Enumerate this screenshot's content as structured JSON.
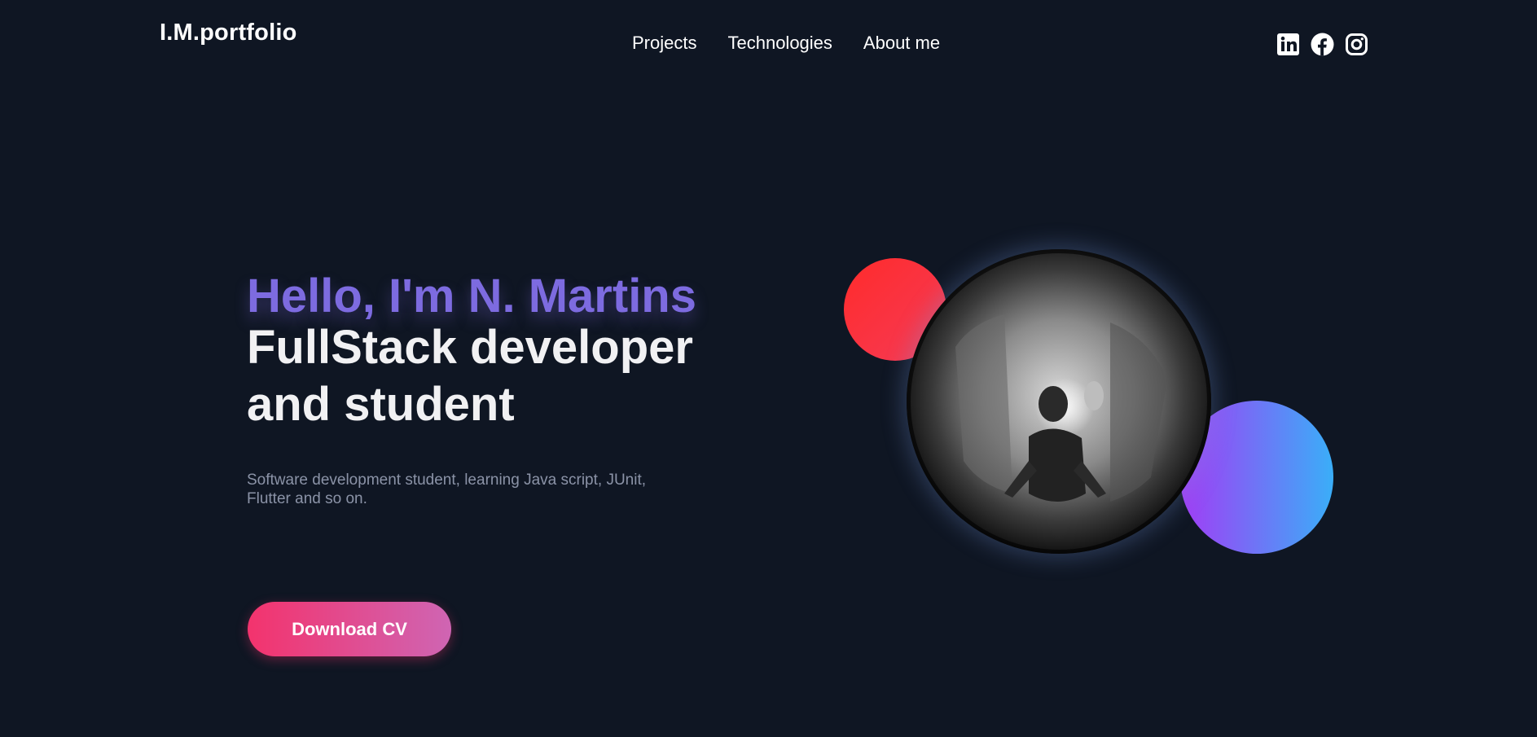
{
  "header": {
    "logo": "I.M.portfolio",
    "nav": [
      {
        "label": "Projects"
      },
      {
        "label": "Technologies"
      },
      {
        "label": "About me"
      }
    ],
    "social_icons": [
      "linkedin-icon",
      "facebook-icon",
      "instagram-icon"
    ]
  },
  "hero": {
    "greeting": "Hello, I'm N. Martins",
    "headline": "FullStack developer and student",
    "description": "Software development student, learning Java script, JUnit, Flutter and so on.",
    "cta_label": "Download CV"
  },
  "colors": {
    "background": "#0f1623",
    "greeting": "#7d6be0",
    "cta_gradient_start": "#f3336d",
    "cta_gradient_end": "#cf65b3",
    "red_circle": "#ff2b2b",
    "blue_circle_start": "#a23cf5",
    "blue_circle_end": "#3aaef8"
  }
}
